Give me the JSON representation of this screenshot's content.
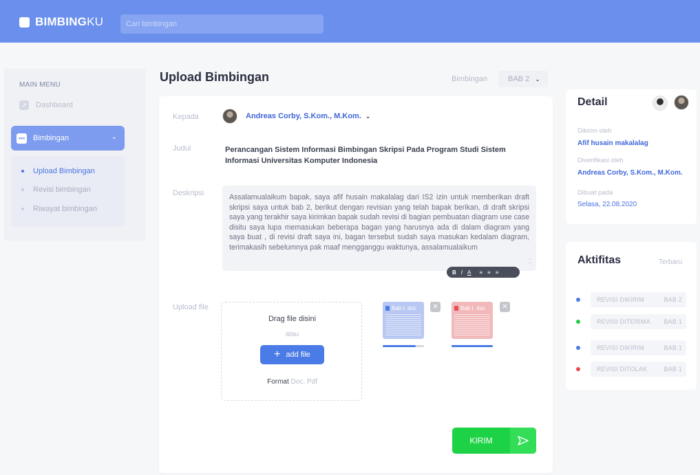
{
  "brand": {
    "bold": "BIMBING",
    "light": "KU"
  },
  "search": {
    "placeholder": "Cari bimbingan"
  },
  "sidebar": {
    "menu_title": "MAIN MENU",
    "dashboard": "Dashboard",
    "active_item": "Bimbingan",
    "submenu": [
      "Upload Bimbingan",
      "Revisi bimbingan",
      "Riwayat bimbingan"
    ]
  },
  "main": {
    "title": "Upload Bimbingan",
    "bab_label": "Bimbingan",
    "bab_value": "BAB 2"
  },
  "form": {
    "to_label": "Kepada",
    "to_name": "Andreas Corby, S.Kom., M.Kom.",
    "title_label": "Judul",
    "title_value": "Perancangan Sistem Informasi Bimbingan Skripsi Pada Program Studi Sistem Informasi Universitas Komputer Indonesia",
    "desc_label": "Deskripsi",
    "desc_value": "Assalamualaikum bapak, saya afif husain makalalag dari IS2 izin untuk memberikan draft skripsi saya untuk bab 2, berikut dengan revisian yang telah bapak berikan, di draft skripsi saya yang terakhir saya kirimkan bapak sudah revisi di bagian pembuatan diagram use case disitu saya lupa memasukan beberapa bagan yang harusnya ada di dalam diagram yang saya buat , di revisi draft saya ini, bagan tersebut sudah saya masukan kedalam diagram,  terimakasih sebelumnya pak maaf mengganggu waktunya, assalamualaikum",
    "toolbar": [
      "B",
      "I",
      "A",
      "≡",
      "≡",
      "≡"
    ],
    "upload_label": "Upload file",
    "drop_title": "Drag file disini",
    "drop_or": "atau",
    "add_file": "add file",
    "format_label": "Format",
    "format_value": "Doc, Pdf",
    "files": [
      {
        "name": "Bab I. doc",
        "progress": 0.8
      },
      {
        "name": "Bab I. doc",
        "progress": 1.0
      }
    ],
    "submit": "KIRIM"
  },
  "detail": {
    "title": "Detail",
    "sent_by_label": "Dikirim oleh",
    "sent_by": "Afif husain makalalag",
    "verified_by_label": "Diverifikasi oleh",
    "verified_by": "Andreas Corby, S.Kom., M.Kom.",
    "created_label": "Dibuat pada",
    "created": "Selasa, 22.08.2020"
  },
  "activity": {
    "title": "Aktifitas",
    "latest": "Terbaru",
    "items": [
      {
        "status": "REVISI DIKIRIM",
        "bab": "BAB 2",
        "color": "#4a7be6"
      },
      {
        "status": "REVISI DITERIMA",
        "bab": "BAB 1",
        "color": "#22cc44"
      },
      {
        "status": "REVISI DIKIRIM",
        "bab": "BAB 1",
        "color": "#4a7be6"
      },
      {
        "status": "REVISI DITOLAK",
        "bab": "BAB 1",
        "color": "#e84a4f"
      }
    ]
  },
  "colors": {
    "primary": "#6a8fec",
    "accent": "#4a7be6",
    "success": "#1ed245",
    "danger": "#e84a4f"
  }
}
